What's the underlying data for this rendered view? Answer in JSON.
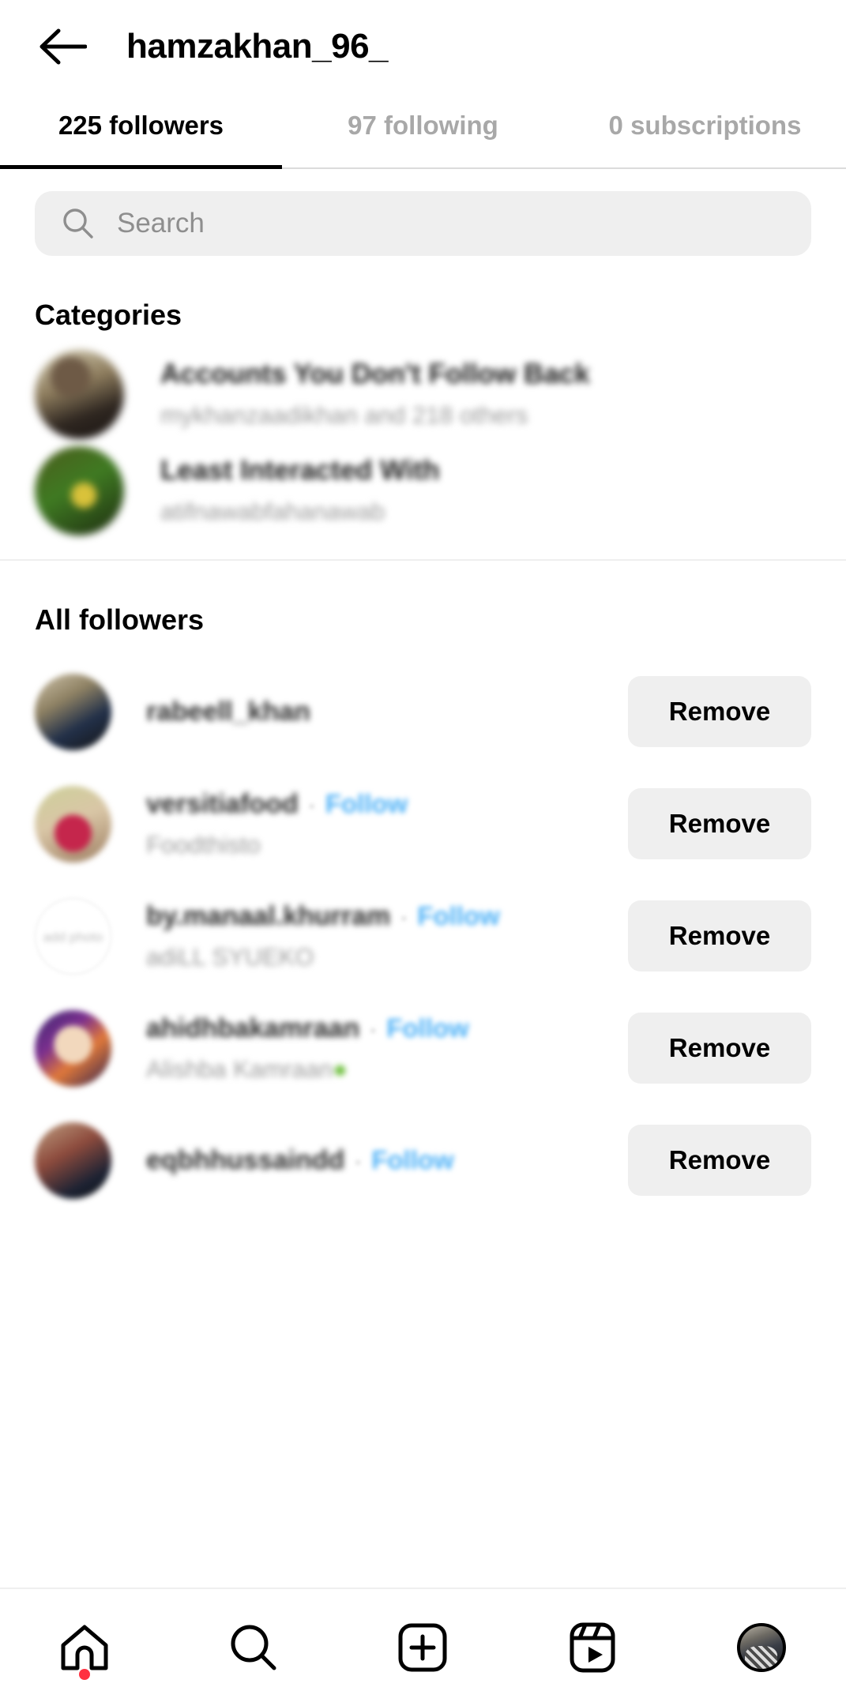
{
  "header": {
    "back_icon": "back-arrow-icon",
    "title": "hamzakhan_96_"
  },
  "tabs": [
    {
      "label": "225 followers",
      "active": true
    },
    {
      "label": "97 following",
      "active": false
    },
    {
      "label": "0 subscriptions",
      "active": false
    }
  ],
  "search": {
    "icon": "search-icon",
    "placeholder": "Search",
    "value": ""
  },
  "categories": {
    "heading": "Categories",
    "items": [
      {
        "title": "Accounts You Don't Follow Back",
        "subtitle": "mykhanzaadikhan and 218 others",
        "blurred": true
      },
      {
        "title": "Least Interacted With",
        "subtitle": "atifnawabfahanawab",
        "blurred": true
      }
    ]
  },
  "all_followers": {
    "heading": "All followers",
    "action_label": "Remove",
    "follow_label": "Follow",
    "separator": "·",
    "items": [
      {
        "username": "rabeell_khan",
        "fullname": "",
        "show_follow": false,
        "blank_avatar_label": ""
      },
      {
        "username": "versitiafood",
        "fullname": "Foodthisto",
        "show_follow": true,
        "blank_avatar_label": ""
      },
      {
        "username": "by.manaal.khurram",
        "fullname": "adiLL SYUEKO",
        "show_follow": true,
        "blank_avatar_label": "add photo"
      },
      {
        "username": "ahidhbakamraan",
        "fullname": "Alishba Kamraan",
        "fullname_emoji": "●",
        "show_follow": true,
        "blank_avatar_label": ""
      },
      {
        "username": "eqbhhussaindd",
        "fullname": "",
        "show_follow": true,
        "blank_avatar_label": ""
      }
    ]
  },
  "bottom_nav": {
    "items": [
      {
        "name": "home-icon",
        "label": "Home",
        "badge": true,
        "active": false
      },
      {
        "name": "search-icon",
        "label": "Search",
        "badge": false,
        "active": false
      },
      {
        "name": "create-icon",
        "label": "Create",
        "badge": false,
        "active": false
      },
      {
        "name": "reels-icon",
        "label": "Reels",
        "badge": false,
        "active": false
      },
      {
        "name": "profile-avatar",
        "label": "Profile",
        "badge": false,
        "active": true
      }
    ]
  },
  "colors": {
    "accent_follow": "#4db1f7",
    "chip_bg": "#efefef",
    "muted_text": "#8e8e8e",
    "badge": "#ff3040"
  }
}
